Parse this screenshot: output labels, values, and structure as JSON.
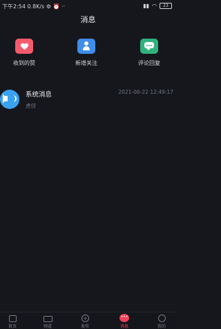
{
  "status_bar": {
    "time": "下午2:54",
    "speed": "0.8K/s",
    "battery": "23"
  },
  "header": {
    "title": "消息"
  },
  "quick_actions": [
    {
      "label": "收到的赞",
      "icon": "heart-icon",
      "color": "#f35b6c"
    },
    {
      "label": "新增关注",
      "icon": "person-icon",
      "color": "#3f8de8"
    },
    {
      "label": "评论回复",
      "icon": "comment-icon",
      "color": "#30b27d"
    }
  ],
  "messages": [
    {
      "name": "系统消息",
      "time": "2021-06-22 12:49:17",
      "preview": "虎伢",
      "icon": "speaker-icon"
    }
  ],
  "tab_bar": {
    "tabs": [
      {
        "label": "首页",
        "icon": "home-icon"
      },
      {
        "label": "频道",
        "icon": "tv-icon"
      },
      {
        "label": "发布",
        "icon": "plus-icon"
      },
      {
        "label": "消息",
        "icon": "message-icon",
        "active": true
      },
      {
        "label": "我的",
        "icon": "profile-icon"
      }
    ]
  },
  "colors": {
    "background": "#15171d",
    "accent": "#f0425a"
  }
}
